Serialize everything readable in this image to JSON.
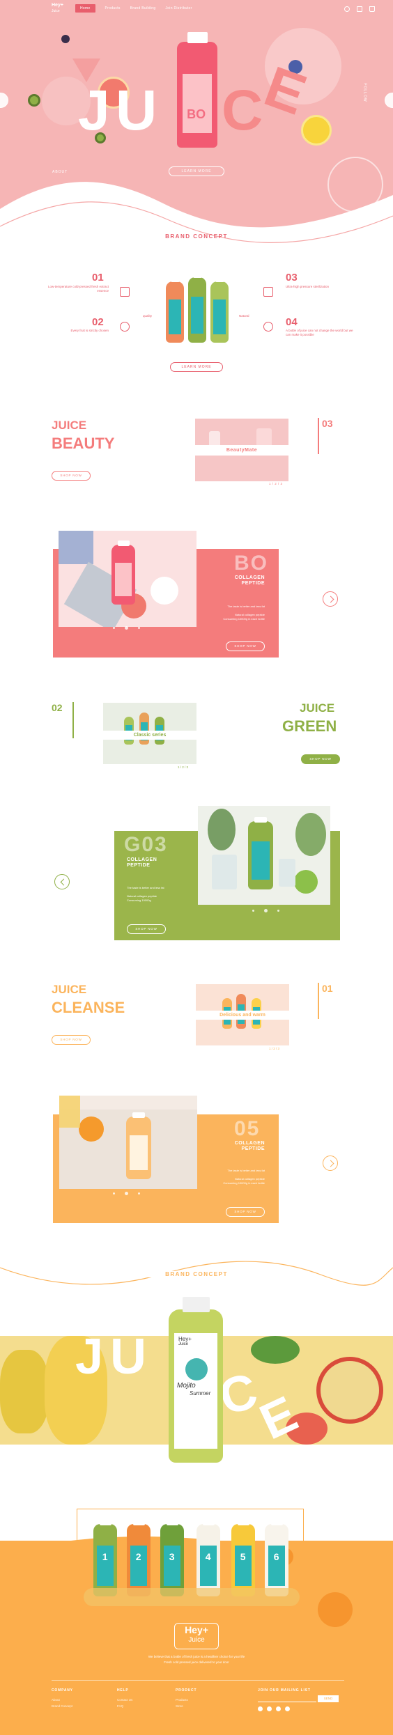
{
  "nav": {
    "logo_line1": "Hey+",
    "logo_line2": "Juice",
    "links": [
      "Home",
      "Products",
      "Brand Building",
      "Join Distributor"
    ],
    "icons": [
      "search-icon",
      "user-icon",
      "cart-icon"
    ]
  },
  "hero": {
    "word_j": "J",
    "word_u": "U",
    "word_i": "I",
    "word_c": "C",
    "word_e": "E",
    "bottle_code": "BO",
    "side_text": "FOLLOW",
    "bottom_left": "ABOUT",
    "learn_more": "LEARN MORE"
  },
  "brand": {
    "title": "BRAND CONCEPT",
    "features": [
      {
        "num": "01",
        "text": "Low-temperature cold-pressed fresh extract essence"
      },
      {
        "num": "02",
        "text": "Every fruit is strictly chosen"
      },
      {
        "num": "03",
        "text": "Ultra-high pressure sterilization"
      },
      {
        "num": "04",
        "text": "A bottle of juice can not change the world but we can make it possible"
      }
    ],
    "side_left": "quality",
    "side_right": "Natural",
    "learn_more": "LEARN MORE"
  },
  "beauty": {
    "juice": "JUICE",
    "name": "BEAUTY",
    "shop": "SHOP NOW",
    "num": "03",
    "banner": "BeautyMate",
    "pager": "1 / 2 / 3",
    "code": "BO",
    "card_title_1": "COLLAGEN",
    "card_title_2": "PEPTIDE",
    "copy_1": "The taste is better and less fat",
    "copy_2": "Natural collagen peptide",
    "copy_3": "Consuming 10000g in each bottle",
    "card_shop": "SHOP NOW"
  },
  "green": {
    "juice": "JUICE",
    "name": "GREEN",
    "shop": "SHOP NOW",
    "num": "02",
    "banner": "Classic series",
    "pager": "1 / 2 / 3",
    "code": "G03",
    "card_title_1": "COLLAGEN",
    "card_title_2": "PEPTIDE",
    "copy_1": "The taste is better and less fat",
    "copy_2": "Natural collagen peptide",
    "copy_3": "Consuming 10000g",
    "card_shop": "SHOP NOW"
  },
  "cleanse": {
    "juice": "JUICE",
    "name": "CLEANSE",
    "shop": "SHOP NOW",
    "num": "01",
    "banner": "Delicious and warm",
    "pager": "1 / 2 / 3",
    "code": "05",
    "card_title_1": "COLLAGEN",
    "card_title_2": "PEPTIDE",
    "copy_1": "The taste is better and less fat",
    "copy_2": "Natural collagen peptide",
    "copy_3": "Consuming 10000g in each bottle",
    "card_shop": "SHOP NOW"
  },
  "concept2": {
    "title": "BRAND CONCEPT",
    "word_j": "J",
    "word_u": "U",
    "word_i": "I",
    "word_c": "C",
    "word_e": "E",
    "bottle_brand": "Hey+",
    "bottle_sub": "Juice",
    "bottle_flavor": "Mojito",
    "bottle_flavor2": "Summer"
  },
  "lineup": {
    "numbers": [
      "1",
      "2",
      "3",
      "4",
      "5",
      "6"
    ]
  },
  "footer": {
    "logo_line1": "Hey+",
    "logo_line2": "Juice",
    "tagline_1": "We believe that a bottle of fresh juice is a healthier choice for your life",
    "tagline_2": "Fresh cold pressed juice delivered to your door",
    "cols": [
      {
        "title": "COMPANY",
        "items": [
          "About",
          "Brand Concept"
        ]
      },
      {
        "title": "HELP",
        "items": [
          "Contact Us",
          "FAQ"
        ]
      },
      {
        "title": "PRODUCT",
        "items": [
          "Products",
          "Store"
        ]
      }
    ],
    "mailing_title": "JOIN OUR MAILING LIST",
    "mailing_button": "SEND",
    "social": [
      "facebook-icon",
      "twitter-icon",
      "weibo-icon",
      "youtube-icon"
    ]
  },
  "colors": {
    "pink": "#f6b5b5",
    "coral": "#f47c7c",
    "red": "#e85e6c",
    "green": "#9bb54b",
    "orange": "#fbb45c",
    "footer_orange": "#fcae4c"
  }
}
